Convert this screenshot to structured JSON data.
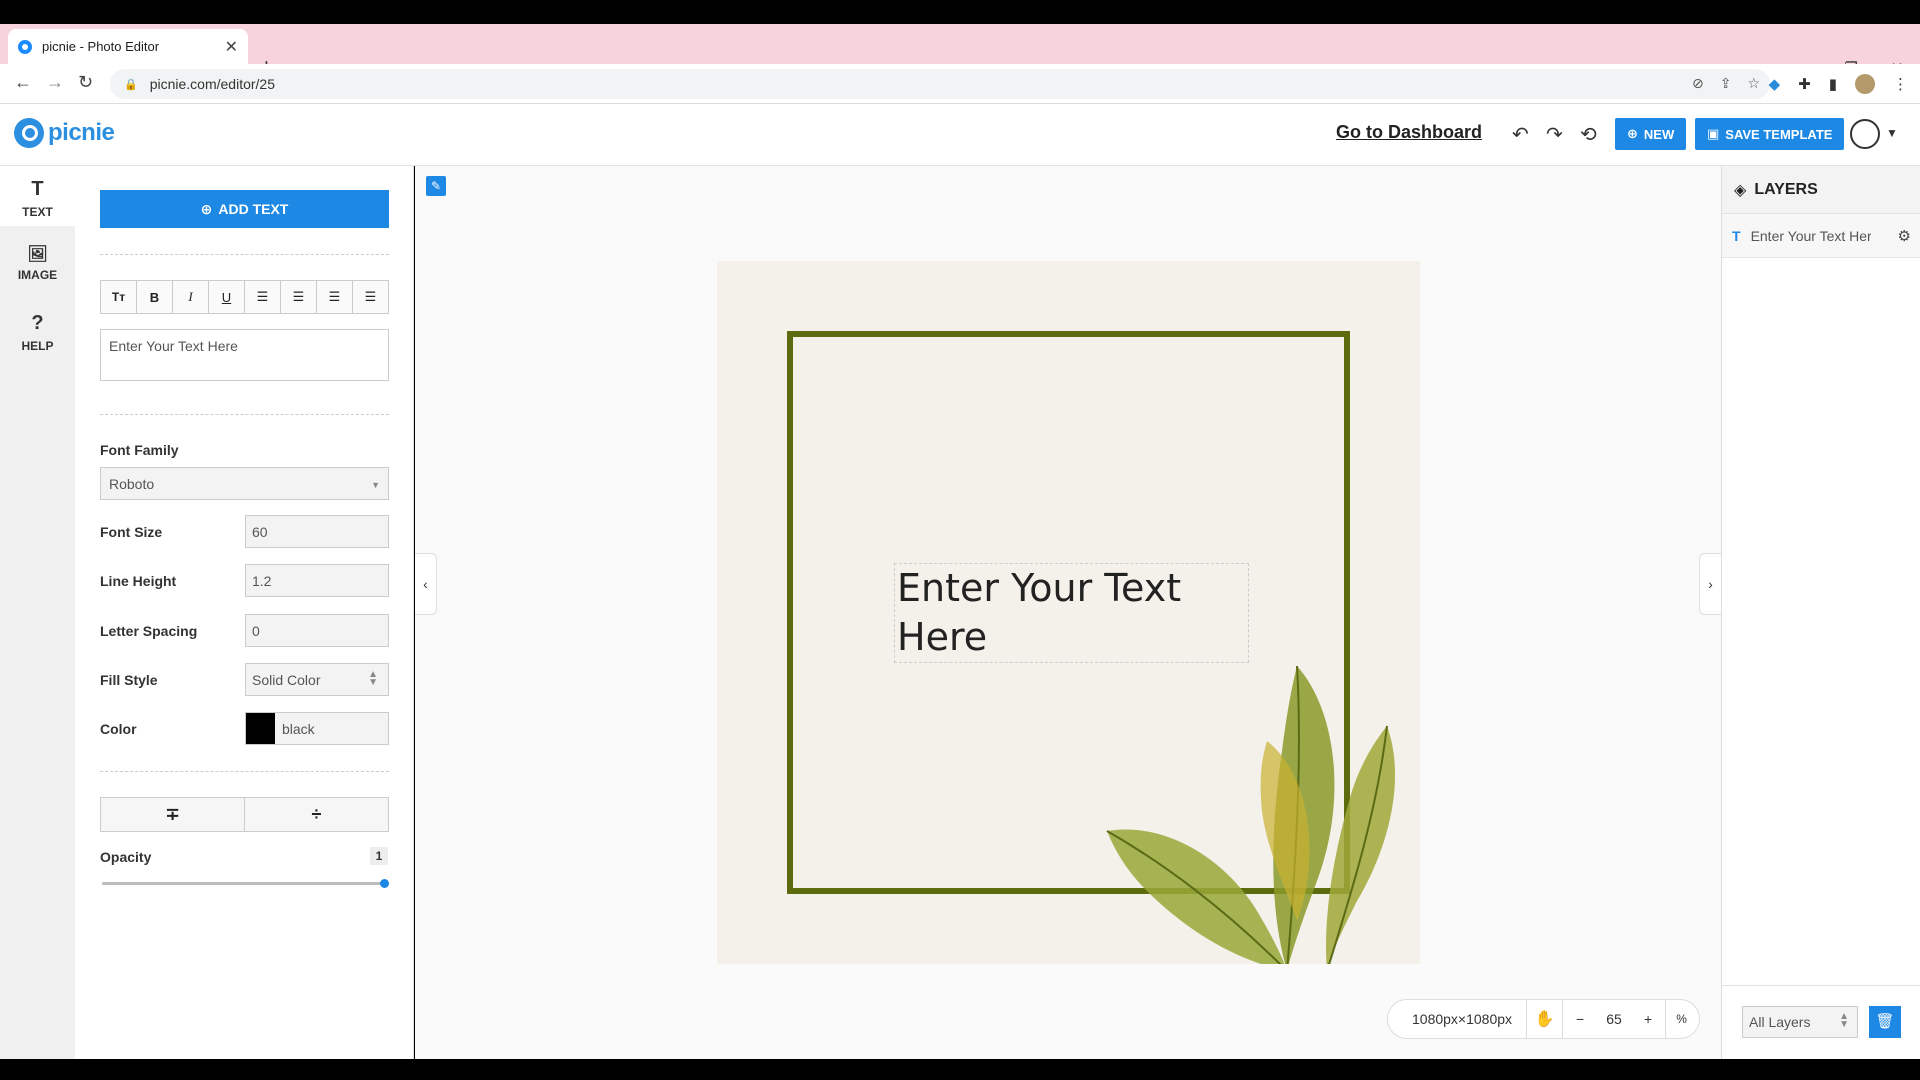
{
  "browser": {
    "tab_title": "picnie - Photo Editor",
    "url": "picnie.com/editor/25",
    "new_tab_label": "+",
    "close_tab_label": "✕"
  },
  "header": {
    "logo_text": "picnie",
    "dashboard_link": "Go to Dashboard",
    "new_label": "NEW",
    "save_template_label": "SAVE TEMPLATE"
  },
  "rail": {
    "items": [
      {
        "icon": "T",
        "label": "TEXT"
      },
      {
        "icon": "🖼",
        "label": "IMAGE"
      },
      {
        "icon": "?",
        "label": "HELP"
      }
    ]
  },
  "panel": {
    "add_text_label": "ADD TEXT",
    "format_buttons": [
      "TT",
      "B",
      "I",
      "U",
      "≡L",
      "≡C",
      "≡R",
      "≡J"
    ],
    "text_value": "Enter Your Text Here",
    "font_family_label": "Font Family",
    "font_family_value": "Roboto",
    "font_size_label": "Font Size",
    "font_size_value": "60",
    "line_height_label": "Line Height",
    "line_height_value": "1.2",
    "letter_spacing_label": "Letter Spacing",
    "letter_spacing_value": "0",
    "fill_style_label": "Fill Style",
    "fill_style_value": "Solid Color",
    "color_label": "Color",
    "color_value": "black",
    "opacity_label": "Opacity",
    "opacity_value": "1"
  },
  "canvas": {
    "text_content_line1": "Enter Your Text",
    "text_content_line2": "Here",
    "dimensions": "1080px×1080px",
    "zoom_value": "65",
    "zoom_minus": "−",
    "zoom_plus": "+",
    "percent_label": "%",
    "frame_color": "#5d6b0f",
    "background_color": "#f3f1ea"
  },
  "layers": {
    "title": "LAYERS",
    "items": [
      {
        "type_icon": "T",
        "name": "Enter Your Text Here"
      }
    ],
    "filter_value": "All Layers"
  },
  "colors": {
    "accent": "#1e88e5",
    "tab_strip": "#f6d3dd"
  }
}
